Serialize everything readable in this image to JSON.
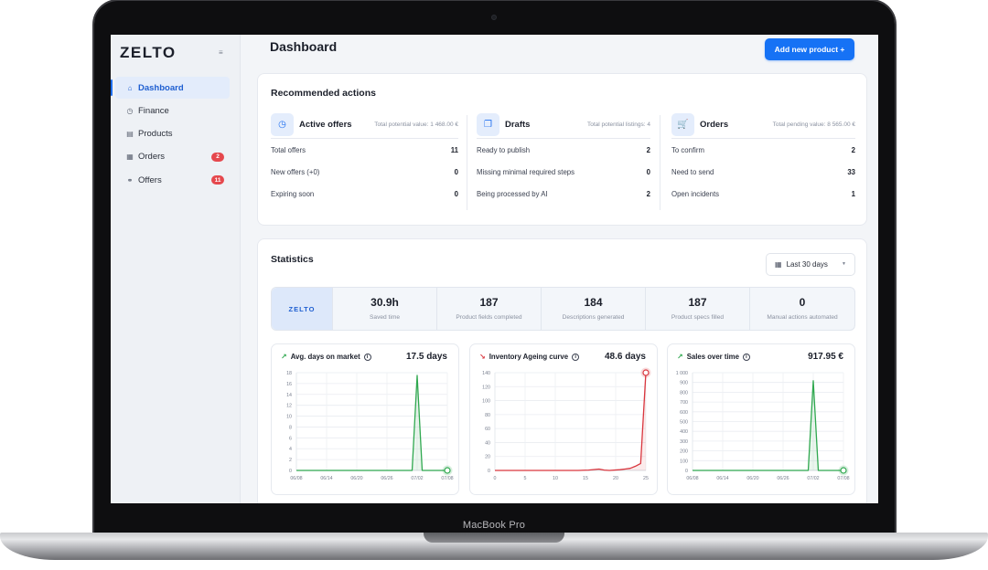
{
  "device": {
    "label": "MacBook Pro"
  },
  "app": {
    "logo": "ZELTO",
    "collapse_icon": "≡"
  },
  "sidebar": {
    "items": [
      {
        "label": "Dashboard",
        "icon": "⌂",
        "active": true,
        "badge": ""
      },
      {
        "label": "Finance",
        "icon": "◷",
        "active": false,
        "badge": ""
      },
      {
        "label": "Products",
        "icon": "▤",
        "active": false,
        "badge": ""
      },
      {
        "label": "Orders",
        "icon": "▦",
        "active": false,
        "badge": "2"
      },
      {
        "label": "Offers",
        "icon": "⚭",
        "active": false,
        "badge": "11"
      }
    ]
  },
  "header": {
    "title": "Dashboard",
    "primary_button": "Add new product +"
  },
  "recommended": {
    "title": "Recommended actions",
    "columns": [
      {
        "name": "Active offers",
        "icon": "◷",
        "meta": "Total potential value: 1 468.00 €",
        "rows": [
          {
            "label": "Total offers",
            "value": "11"
          },
          {
            "label": "New offers (+0)",
            "value": "0"
          },
          {
            "label": "Expiring soon",
            "value": "0"
          }
        ]
      },
      {
        "name": "Drafts",
        "icon": "❐",
        "meta": "Total potential listings: 4",
        "rows": [
          {
            "label": "Ready to publish",
            "value": "2"
          },
          {
            "label": "Missing minimal required steps",
            "value": "0"
          },
          {
            "label": "Being processed by AI",
            "value": "2"
          }
        ]
      },
      {
        "name": "Orders",
        "icon": "🛒",
        "meta": "Total pending value: 8 565.00 €",
        "rows": [
          {
            "label": "To confirm",
            "value": "2"
          },
          {
            "label": "Need to send",
            "value": "33"
          },
          {
            "label": "Open incidents",
            "value": "1"
          }
        ]
      }
    ]
  },
  "statistics": {
    "title": "Statistics",
    "period": "Last 30 days",
    "brand": "ZELTO",
    "kpis": [
      {
        "value": "30.9h",
        "label": "Saved time"
      },
      {
        "value": "187",
        "label": "Product fields completed"
      },
      {
        "value": "184",
        "label": "Descriptions generated"
      },
      {
        "value": "187",
        "label": "Product specs filled"
      },
      {
        "value": "0",
        "label": "Manual actions automated"
      }
    ]
  },
  "chart_data": [
    {
      "type": "line",
      "title": "Avg. days on market",
      "value_label": "17.5 days",
      "color": "#2fa84f",
      "y_ticks": [
        "0",
        "2",
        "4",
        "6",
        "8",
        "10",
        "12",
        "14",
        "16",
        "18"
      ],
      "x_ticks": [
        "06/08",
        "06/14",
        "06/20",
        "06/26",
        "07/02",
        "07/08"
      ],
      "ylim": [
        0,
        18
      ],
      "x": [
        0,
        1,
        2,
        3,
        4,
        5,
        6,
        7,
        8,
        9,
        10,
        11,
        12,
        13,
        14,
        15,
        16,
        17,
        18,
        19,
        20,
        21,
        22,
        23,
        24,
        25,
        26,
        27,
        28,
        29,
        30
      ],
      "y": [
        0,
        0,
        0,
        0,
        0,
        0,
        0,
        0,
        0,
        0,
        0,
        0,
        0,
        0,
        0,
        0,
        0,
        0,
        0,
        0,
        0,
        0,
        0,
        0,
        17.5,
        0,
        0,
        0,
        0,
        0,
        0
      ]
    },
    {
      "type": "line",
      "title": "Inventory Ageing curve",
      "value_label": "48.6 days",
      "color": "#d9363e",
      "y_ticks": [
        "0",
        "20",
        "40",
        "60",
        "80",
        "100",
        "120",
        "140"
      ],
      "x_ticks": [
        "0",
        "5",
        "10",
        "15",
        "20",
        "25"
      ],
      "ylim": [
        0,
        140
      ],
      "x": [
        0,
        2,
        4,
        6,
        8,
        10,
        12,
        14,
        16,
        18,
        20,
        21,
        22,
        24,
        25,
        26,
        27,
        28,
        29
      ],
      "y": [
        0,
        0,
        0,
        0,
        0,
        0,
        0,
        0,
        0,
        0.5,
        2,
        0.5,
        0,
        1,
        2,
        3,
        6,
        10,
        140
      ]
    },
    {
      "type": "line",
      "title": "Sales over time",
      "value_label": "917.95 €",
      "color": "#2fa84f",
      "y_ticks": [
        "0",
        "100",
        "200",
        "300",
        "400",
        "500",
        "600",
        "700",
        "800",
        "900",
        "1 000"
      ],
      "x_ticks": [
        "06/08",
        "06/14",
        "06/20",
        "06/26",
        "07/02",
        "07/08"
      ],
      "ylim": [
        0,
        1000
      ],
      "x": [
        0,
        1,
        2,
        3,
        4,
        5,
        6,
        7,
        8,
        9,
        10,
        11,
        12,
        13,
        14,
        15,
        16,
        17,
        18,
        19,
        20,
        21,
        22,
        23,
        24,
        25,
        26,
        27,
        28,
        29,
        30
      ],
      "y": [
        0,
        0,
        0,
        0,
        0,
        0,
        0,
        0,
        0,
        0,
        0,
        0,
        0,
        0,
        0,
        0,
        0,
        0,
        0,
        0,
        0,
        0,
        0,
        0,
        917.95,
        0,
        0,
        0,
        0,
        0,
        0
      ]
    }
  ]
}
